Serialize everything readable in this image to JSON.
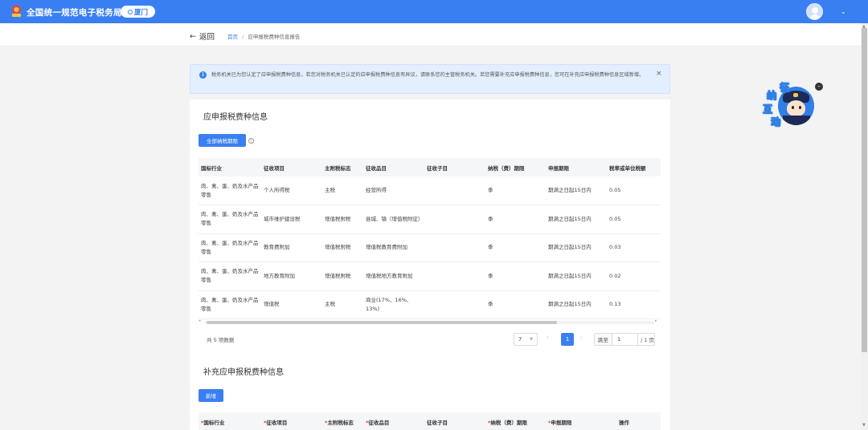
{
  "header": {
    "app_title": "全国统一规范电子税务局",
    "city": "厦门",
    "user_menu_icon": "chevron-down"
  },
  "subheader": {
    "back_label": "返回",
    "breadcrumb": [
      "首页",
      "应申报税费种信息报告"
    ]
  },
  "notice": {
    "text": "税务机关已为您认定了应申报税费种信息，若您对税务机关已认定的应申报税费种信息有异议，请联系您的主管税务机关。若您需要补充应申报税费种信息，您可在补充应申报税费种信息区域新增。",
    "close": "×"
  },
  "section1": {
    "title": "应申报税费种信息",
    "button": "全部纳税期限",
    "help": "i",
    "columns": [
      "国标行业",
      "征收项目",
      "主附税标志",
      "征收品目",
      "征收子目",
      "纳税（费）期限",
      "申报期限",
      "税率或单位税额"
    ],
    "rows": [
      [
        "肉、禽、蛋、奶及水产品零售",
        "个人所得税",
        "主税",
        "经营所得",
        "",
        "季",
        "期满之日起15日内",
        "0.05"
      ],
      [
        "肉、禽、蛋、奶及水产品零售",
        "城市维护建设税",
        "增值税附税",
        "县城、镇（增值税附征）",
        "",
        "季",
        "期满之日起15日内",
        "0.05"
      ],
      [
        "肉、禽、蛋、奶及水产品零售",
        "教育费附加",
        "增值税附税",
        "增值税教育费附加",
        "",
        "季",
        "期满之日起15日内",
        "0.03"
      ],
      [
        "肉、禽、蛋、奶及水产品零售",
        "地方教育附加",
        "增值税附税",
        "增值税地方教育附加",
        "",
        "季",
        "期满之日起15日内",
        "0.02"
      ],
      [
        "肉、禽、蛋、奶及水产品零售",
        "增值税",
        "主税",
        "商业(17%、16%、13%)",
        "",
        "季",
        "期满之日起15日内",
        "0.13"
      ]
    ],
    "total": "共 5 项数据",
    "page_size": "7",
    "current_page": "1",
    "jump_label": "跳至",
    "jump_value": "1",
    "jump_suffix": "/ 1 页"
  },
  "section2": {
    "title": "补充应申报税费种信息",
    "button": "新增",
    "columns": [
      "国标行业",
      "征收项目",
      "主附税标志",
      "征收品目",
      "征收子目",
      "纳税（费）期限",
      "申报期限",
      "操作"
    ],
    "required_mark": "*"
  },
  "mascot": {
    "chars": [
      "征",
      "纳",
      "互",
      "动"
    ],
    "minimize": "–"
  },
  "colors": {
    "primary": "#3a7ff2",
    "notice_bg": "#e3efff"
  }
}
